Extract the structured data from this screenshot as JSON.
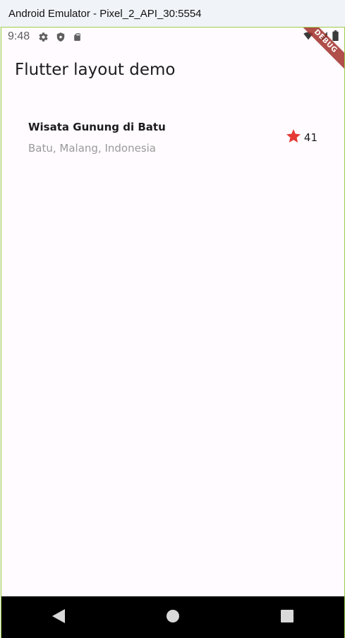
{
  "window": {
    "title": "Android Emulator - Pixel_2_API_30:5554"
  },
  "statusbar": {
    "time": "9:48",
    "icons_left": [
      "gear-icon",
      "shield-icon",
      "sd-card-icon"
    ],
    "icons_right": [
      "wifi-icon",
      "signal-icon",
      "battery-icon"
    ]
  },
  "debug_banner": {
    "label": "DEBUG"
  },
  "appbar": {
    "title": "Flutter layout demo"
  },
  "title_section": {
    "name": "Wisata Gunung di Batu",
    "location": "Batu, Malang, Indonesia",
    "rating_icon": "star-icon",
    "rating_count": "41"
  },
  "navbar": {
    "buttons": [
      "back-icon",
      "home-icon",
      "recents-icon"
    ]
  },
  "colors": {
    "star": "#e53935",
    "ribbon": "#a3302b",
    "background": "#fffbfe",
    "frame_border": "#9fcf4a"
  }
}
